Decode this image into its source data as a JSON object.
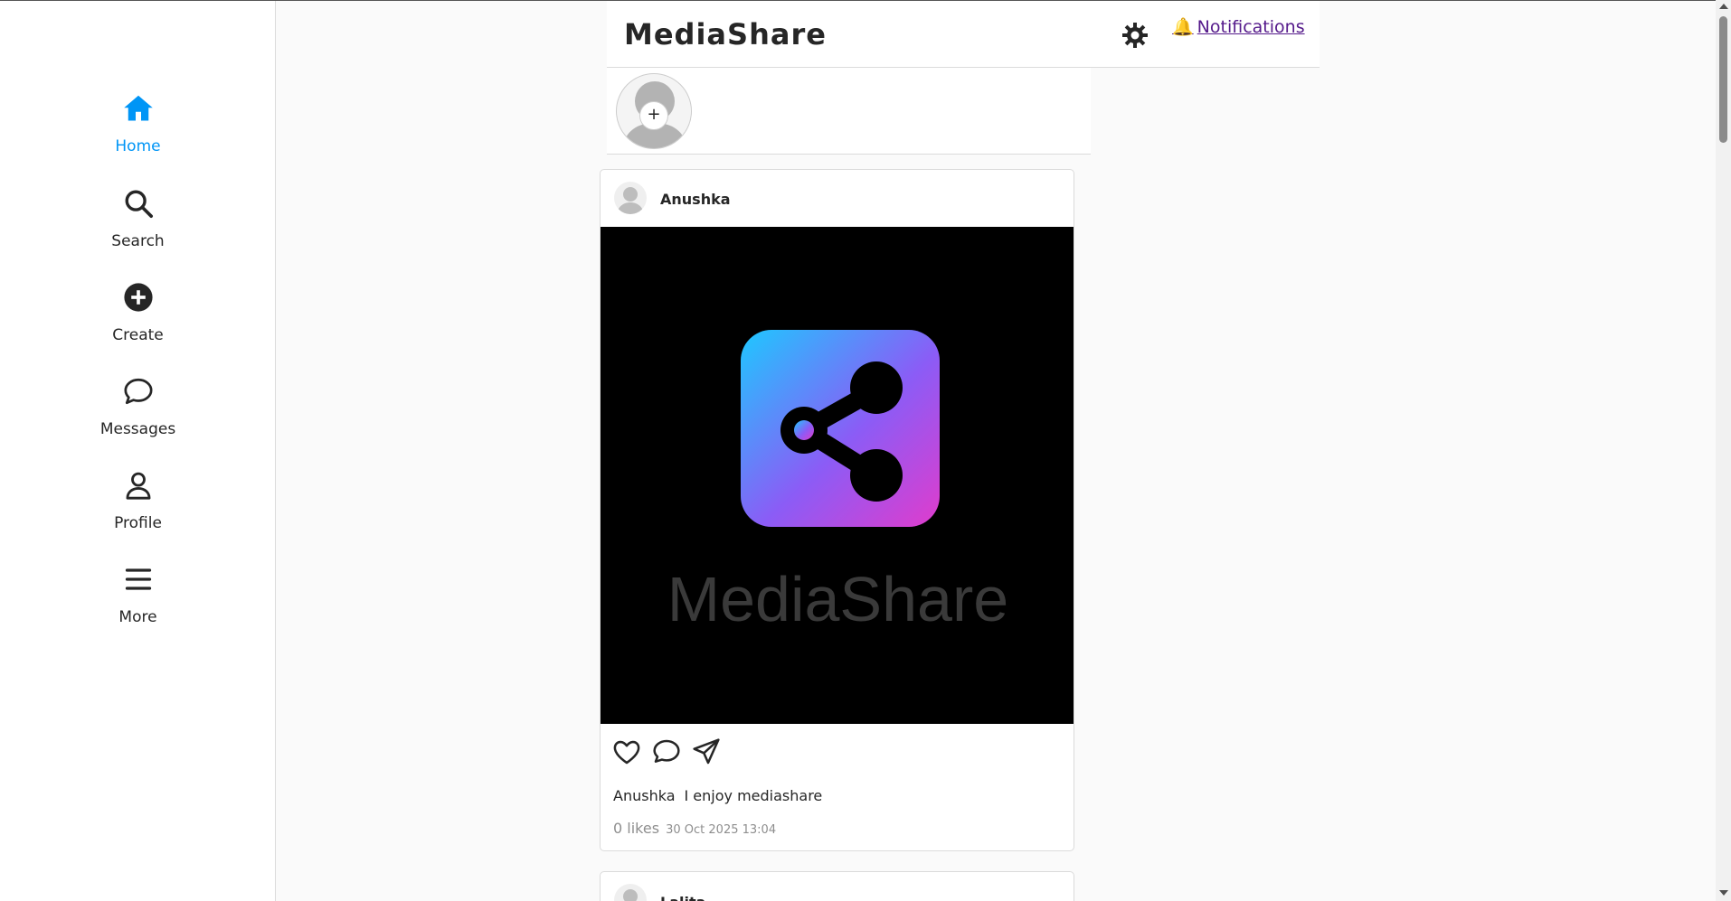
{
  "app": {
    "brand": "MediaShare"
  },
  "colors": {
    "accent": "#0095f6",
    "link": "#551a8b",
    "text": "#262626",
    "muted": "#8e8e8e",
    "logo_gradient_start": "#1ec8ff",
    "logo_gradient_end": "#e03ccc"
  },
  "sidebar": {
    "items": [
      {
        "label": "Home",
        "icon": "home-icon",
        "active": true
      },
      {
        "label": "Search",
        "icon": "search-icon"
      },
      {
        "label": "Create",
        "icon": "plus-circle-icon"
      },
      {
        "label": "Messages",
        "icon": "chat-bubble-icon"
      },
      {
        "label": "Profile",
        "icon": "user-icon"
      },
      {
        "label": "More",
        "icon": "hamburger-menu-icon"
      }
    ]
  },
  "header": {
    "theme_icon": "sun-gear-icon",
    "notifications_label": "Notifications",
    "notifications_icon": "bell-icon"
  },
  "stories": {
    "add_symbol": "+"
  },
  "posts": [
    {
      "username": "Anushka",
      "image": {
        "logo_text": "MediaShare",
        "logo_icon": "share-icon"
      },
      "actions": [
        "heart-icon",
        "comment-icon",
        "send-icon"
      ],
      "caption_user": "Anushka",
      "caption_text": "I enjoy mediashare",
      "likes": "0 likes",
      "timestamp": "30 Oct 2025 13:04"
    },
    {
      "username": "Lalita"
    }
  ]
}
